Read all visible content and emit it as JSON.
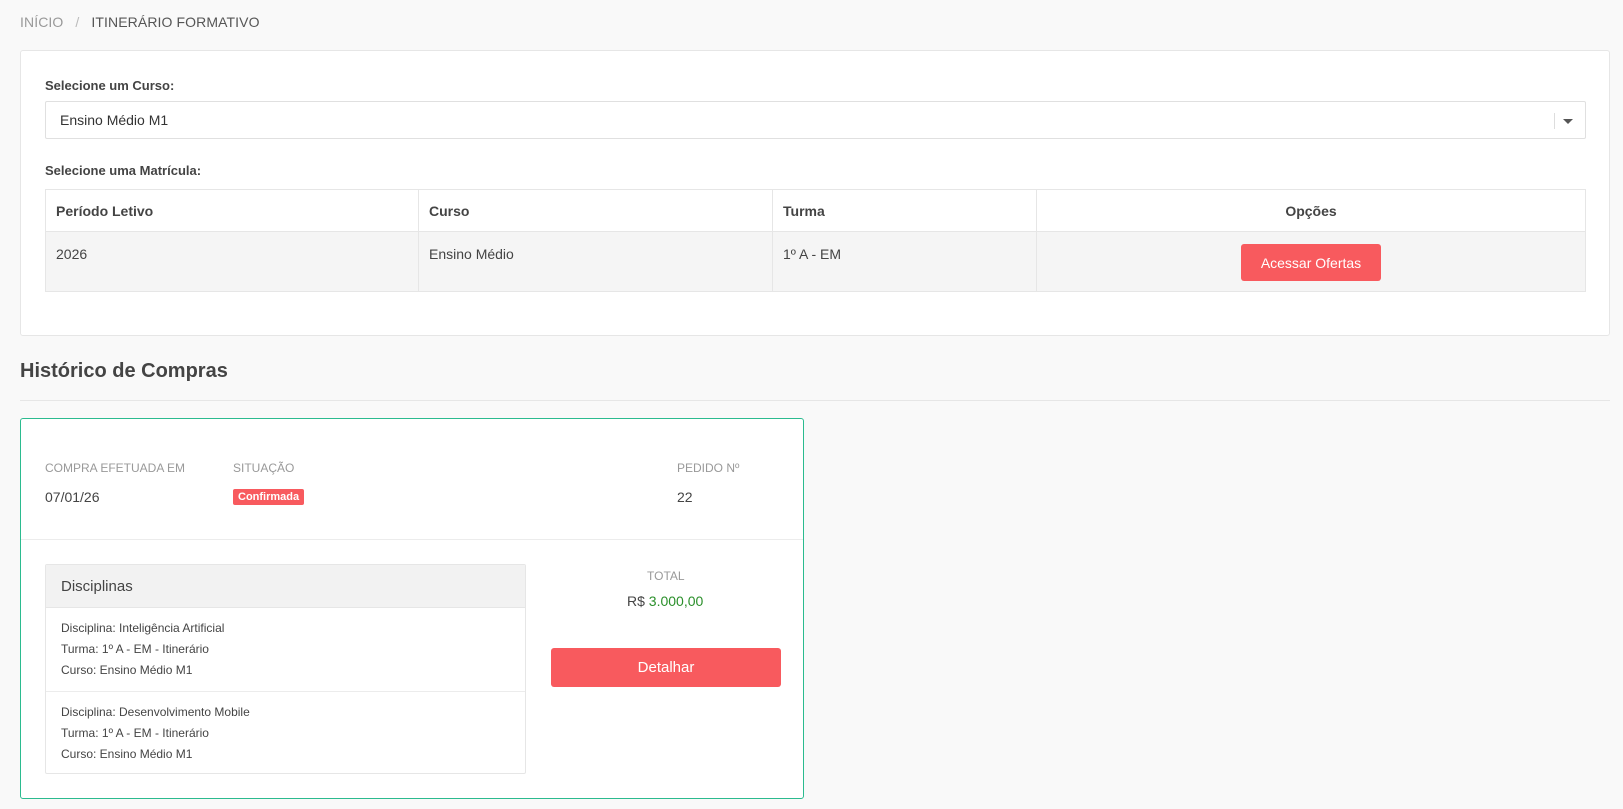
{
  "breadcrumb": {
    "home": "INÍCIO",
    "separator": "/",
    "current": "ITINERÁRIO FORMATIVO"
  },
  "course_select": {
    "label": "Selecione um Curso:",
    "selected": "Ensino Médio M1"
  },
  "enrollment": {
    "label": "Selecione uma Matrícula:",
    "headers": [
      "Período Letivo",
      "Curso",
      "Turma",
      "Opções"
    ],
    "rows": [
      {
        "period": "2026",
        "course": "Ensino Médio",
        "class": "1º A - EM",
        "action": "Acessar Ofertas"
      }
    ]
  },
  "history": {
    "title": "Histórico de Compras",
    "purchase": {
      "date_label": "COMPRA EFETUADA EM",
      "date": "07/01/26",
      "status_label": "SITUAÇÃO",
      "status": "Confirmada",
      "order_label": "PEDIDO Nº",
      "order": "22",
      "disciplines_header": "Disciplinas",
      "disciplines": [
        {
          "discipline": "Disciplina: Inteligência Artificial",
          "class": "Turma: 1º A - EM - Itinerário",
          "course": "Curso: Ensino Médio M1"
        },
        {
          "discipline": "Disciplina: Desenvolvimento Mobile",
          "class": "Turma: 1º A - EM - Itinerário",
          "course": "Curso: Ensino Médio M1"
        }
      ],
      "total_label": "TOTAL",
      "currency": "R$",
      "total": "3.000,00",
      "detail_button": "Detalhar"
    }
  },
  "colors": {
    "accent_red": "#f85a5e",
    "card_border": "#2bbb8f",
    "total_green": "#2a8f2a"
  }
}
